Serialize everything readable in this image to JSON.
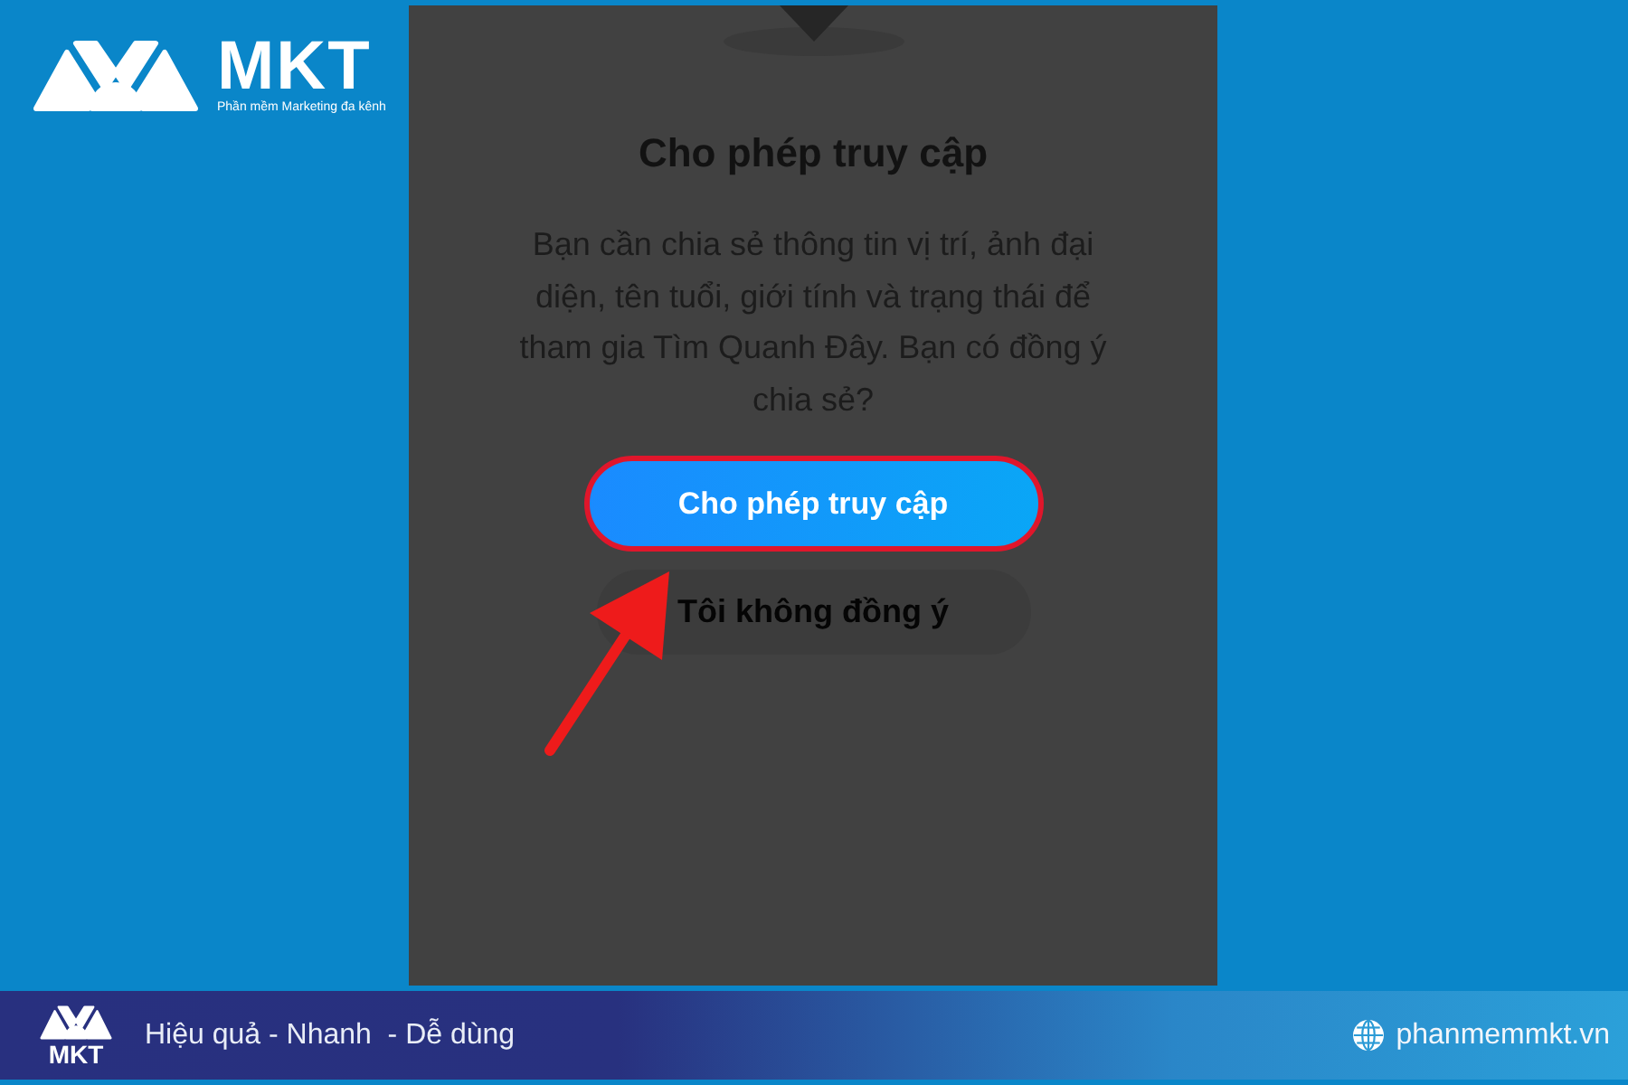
{
  "logo": {
    "wordmark": "MKT",
    "tagline": "Phần mềm Marketing đa kênh"
  },
  "dialog": {
    "title": "Cho phép truy cập",
    "message": "Bạn cần chia sẻ thông tin vị trí, ảnh đại diện, tên tuổi, giới tính và trạng thái để tham gia Tìm Quanh Đây. Bạn có đồng ý chia sẻ?",
    "buttons": [
      {
        "label": "Cho phép truy cập",
        "kind": "primary",
        "highlighted": true
      },
      {
        "label": "Tôi không đồng ý",
        "kind": "secondary",
        "highlighted": false
      }
    ]
  },
  "footer": {
    "logo_wordmark": "MKT",
    "slogan": "Hiệu quả - Nhanh  - Dễ dùng",
    "website": "phanmemmkt.vn"
  }
}
